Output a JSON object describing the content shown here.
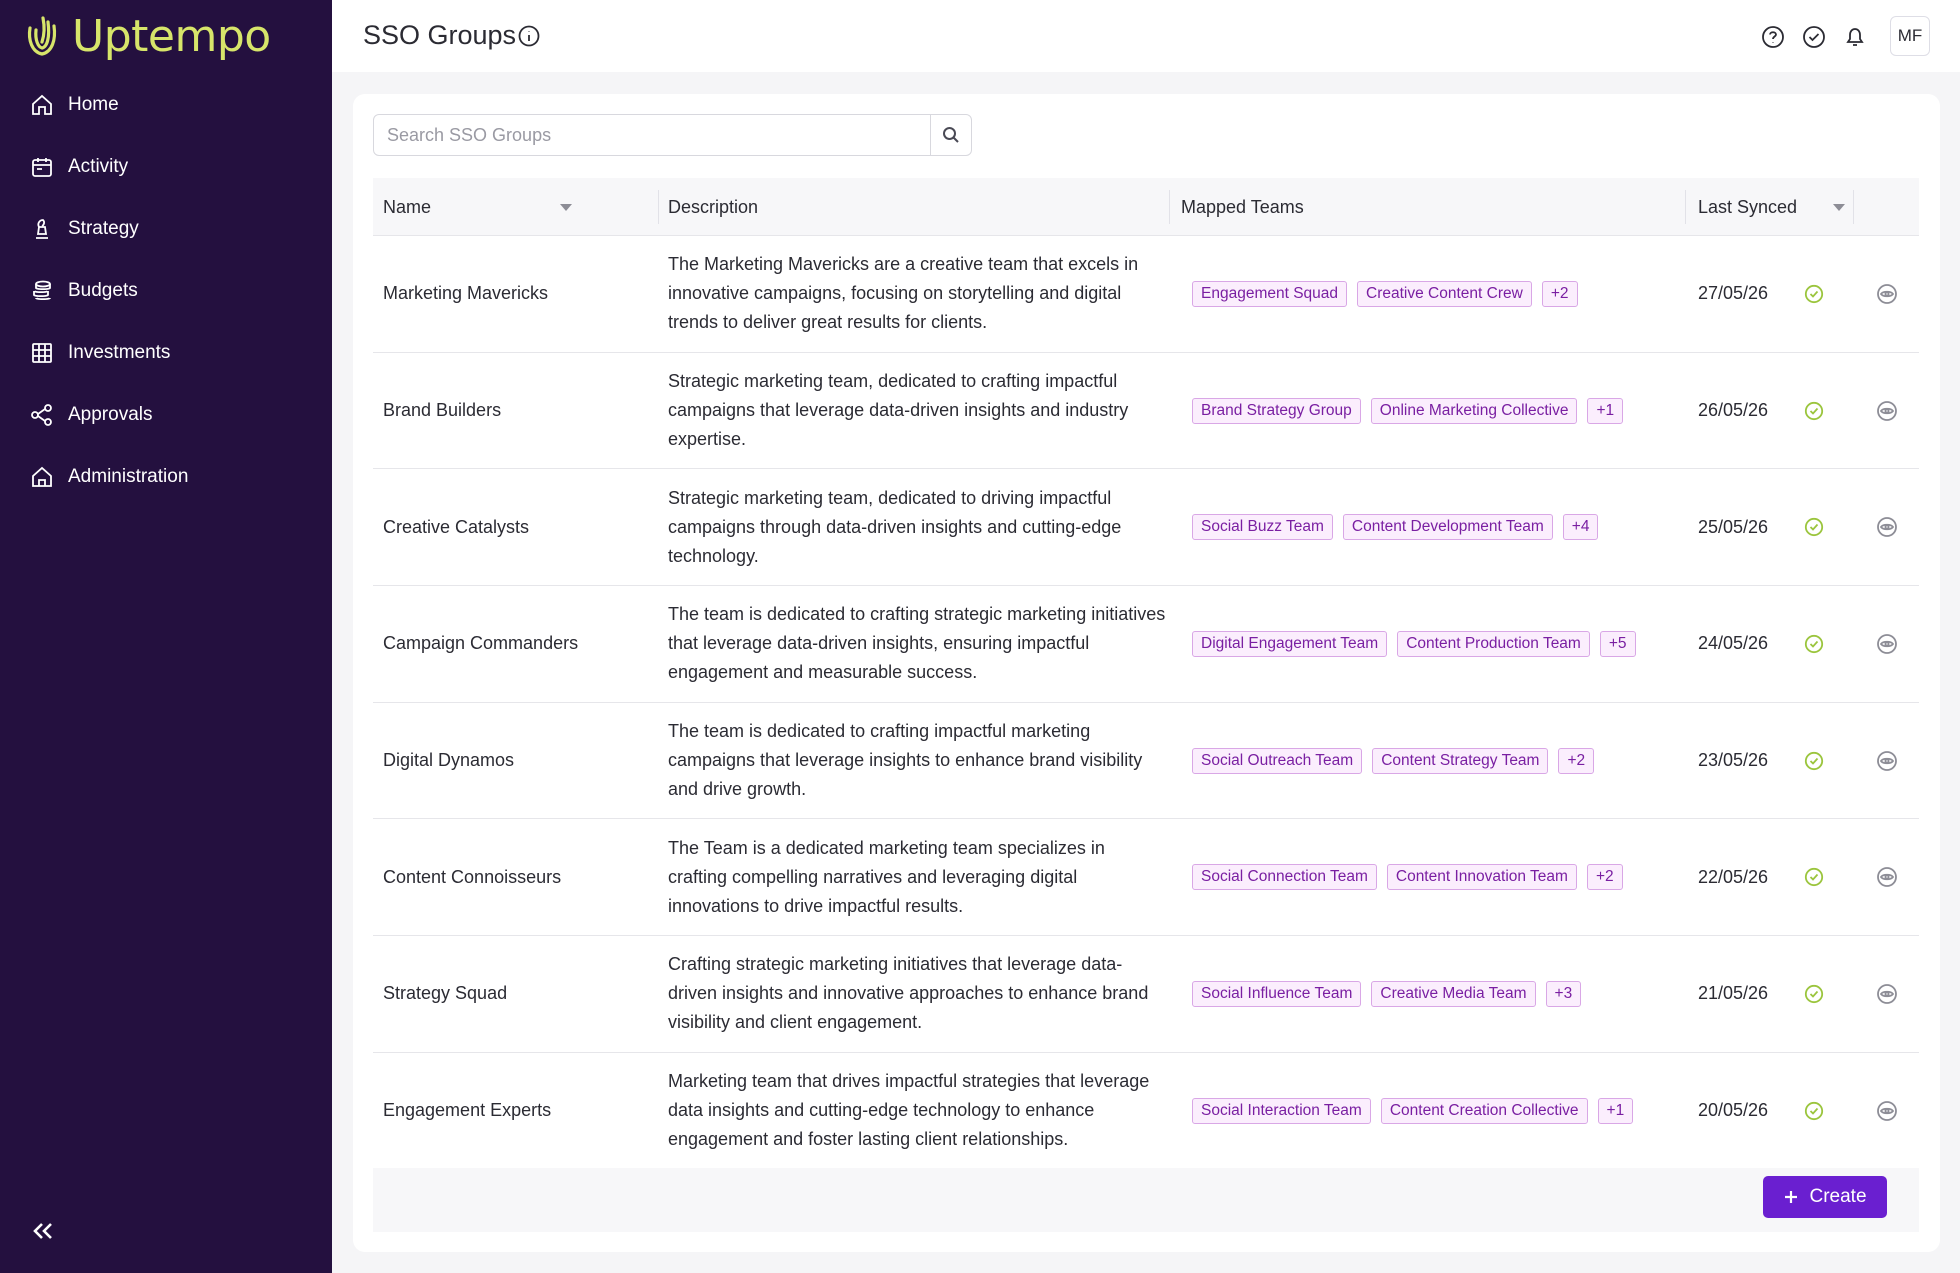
{
  "app": {
    "name": "Uptempo",
    "brand_color": "#d7e56a",
    "sidebar_color": "#24103f",
    "accent_color": "#6a1fd0"
  },
  "sidebar": {
    "items": [
      {
        "label": "Home",
        "icon": "home-icon"
      },
      {
        "label": "Activity",
        "icon": "calendar-icon"
      },
      {
        "label": "Strategy",
        "icon": "chess-icon"
      },
      {
        "label": "Budgets",
        "icon": "coins-icon"
      },
      {
        "label": "Investments",
        "icon": "grid-table-icon"
      },
      {
        "label": "Approvals",
        "icon": "share-nodes-icon"
      },
      {
        "label": "Administration",
        "icon": "admin-home-icon"
      }
    ],
    "collapse_icon": "double-chevron-left-icon"
  },
  "header": {
    "title": "SSO Groups",
    "avatar_initials": "MF",
    "icons": [
      "help-icon",
      "check-circle-icon",
      "bell-icon"
    ]
  },
  "search": {
    "placeholder": "Search SSO Groups",
    "value": ""
  },
  "table": {
    "columns": {
      "name": "Name",
      "description": "Description",
      "mapped_teams": "Mapped Teams",
      "last_synced": "Last Synced"
    },
    "rows": [
      {
        "name": "Marketing Mavericks",
        "description": "The Marketing Mavericks are a creative team that excels in innovative campaigns, focusing on storytelling and digital trends to deliver great results for clients.",
        "teams": [
          "Engagement Squad",
          "Creative Content Crew"
        ],
        "more": "+2",
        "last_synced": "27/05/26",
        "status": "synced"
      },
      {
        "name": "Brand Builders",
        "description": "Strategic marketing team, dedicated to crafting impactful campaigns that leverage data-driven insights and industry expertise.",
        "teams": [
          "Brand Strategy Group",
          "Online Marketing Collective"
        ],
        "more": "+1",
        "last_synced": "26/05/26",
        "status": "synced"
      },
      {
        "name": "Creative Catalysts",
        "description": "Strategic marketing team, dedicated to driving impactful campaigns through data-driven insights and cutting-edge technology.",
        "teams": [
          "Social Buzz Team",
          "Content Development Team"
        ],
        "more": "+4",
        "last_synced": "25/05/26",
        "status": "synced"
      },
      {
        "name": "Campaign Commanders",
        "description": "The team is dedicated to crafting strategic marketing initiatives that leverage data-driven insights, ensuring impactful engagement and measurable success.",
        "teams": [
          "Digital Engagement Team",
          "Content Production Team"
        ],
        "more": "+5",
        "last_synced": "24/05/26",
        "status": "synced"
      },
      {
        "name": "Digital Dynamos",
        "description": "The team is dedicated to crafting impactful marketing campaigns that leverage insights to enhance brand visibility and drive growth.",
        "teams": [
          "Social Outreach Team",
          "Content Strategy Team"
        ],
        "more": "+2",
        "last_synced": "23/05/26",
        "status": "synced"
      },
      {
        "name": "Content Connoisseurs",
        "description": "The Team is a dedicated marketing team specializes in crafting compelling narratives and leveraging digital innovations to drive impactful results.",
        "teams": [
          "Social Connection Team",
          "Content Innovation Team"
        ],
        "more": "+2",
        "last_synced": "22/05/26",
        "status": "synced"
      },
      {
        "name": "Strategy Squad",
        "description": "Crafting strategic marketing initiatives that leverage data-driven insights and innovative approaches to enhance brand visibility and client engagement.",
        "teams": [
          "Social Influence Team",
          "Creative Media Team"
        ],
        "more": "+3",
        "last_synced": "21/05/26",
        "status": "synced"
      },
      {
        "name": "Engagement Experts",
        "description": "Marketing team that drives impactful strategies that leverage data insights and cutting-edge technology to enhance engagement and foster lasting client relationships.",
        "teams": [
          "Social Interaction Team",
          "Content Creation Collective"
        ],
        "more": "+1",
        "last_synced": "20/05/26",
        "status": "synced"
      }
    ]
  },
  "footer": {
    "create_label": "Create"
  }
}
